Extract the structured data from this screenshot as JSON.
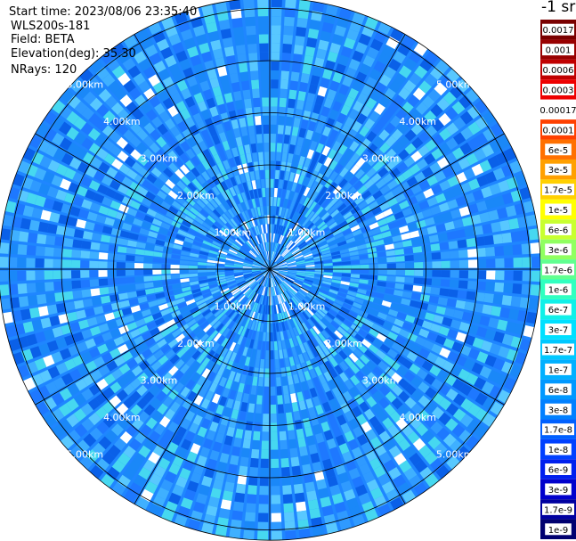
{
  "header": {
    "start_time": "Start time: 2023/08/06 23:35:40",
    "radar": "WLS200s-181",
    "field": "Field: BETA",
    "elevation": "Elevation(deg): 35.30",
    "nrays": "NRays: 120"
  },
  "colorbar": {
    "unit": "-1 sr",
    "levels": [
      {
        "label": "0.0017",
        "color": "#7a0000"
      },
      {
        "label": "0.001",
        "color": "#980000"
      },
      {
        "label": "0.0006",
        "color": "#c00000"
      },
      {
        "label": "0.0003",
        "color": "#ee0000"
      },
      {
        "label": "0.00017",
        "color": "#ffffff"
      },
      {
        "label": "0.0001",
        "color": "#ff4000"
      },
      {
        "label": "6e-5",
        "color": "#ff7000"
      },
      {
        "label": "3e-5",
        "color": "#ffa000"
      },
      {
        "label": "1.7e-5",
        "color": "#ffd000"
      },
      {
        "label": "1e-5",
        "color": "#ffff00"
      },
      {
        "label": "6e-6",
        "color": "#c8ff30"
      },
      {
        "label": "3e-6",
        "color": "#90ff60"
      },
      {
        "label": "1.7e-6",
        "color": "#60ff90"
      },
      {
        "label": "1e-6",
        "color": "#30ffc0"
      },
      {
        "label": "6e-7",
        "color": "#10f0e8"
      },
      {
        "label": "3e-7",
        "color": "#00e0ff"
      },
      {
        "label": "1.7e-7",
        "color": "#00c8ff"
      },
      {
        "label": "1e-7",
        "color": "#00b0ff"
      },
      {
        "label": "6e-8",
        "color": "#0098ff"
      },
      {
        "label": "3e-8",
        "color": "#0080ff"
      },
      {
        "label": "1.7e-8",
        "color": "#0060ff"
      },
      {
        "label": "1e-8",
        "color": "#0040ff"
      },
      {
        "label": "6e-9",
        "color": "#0020ee"
      },
      {
        "label": "3e-9",
        "color": "#0000cc"
      },
      {
        "label": "1.7e-9",
        "color": "#0000a0"
      },
      {
        "label": "1e-9",
        "color": "#000070"
      }
    ]
  },
  "chart_data": {
    "type": "heatmap",
    "projection": "polar (PPI)",
    "range_rings_km": [
      1,
      2,
      3,
      4,
      5
    ],
    "ring_labels": [
      "1.00km",
      "2.00km",
      "3.00km",
      "4.00km",
      "5.00km"
    ],
    "max_range_km": 5.2,
    "azimuth_spokes_deg": [
      0,
      30,
      60,
      90,
      120,
      150,
      180,
      210,
      240,
      270,
      300,
      330
    ],
    "field_palette": [
      "#1e78ff",
      "#2f9aff",
      "#3fb0ff",
      "#0a60e8",
      "#58c8ff",
      "#1a88f8",
      "#46d8f0"
    ],
    "missing_color": "#ffffff"
  }
}
